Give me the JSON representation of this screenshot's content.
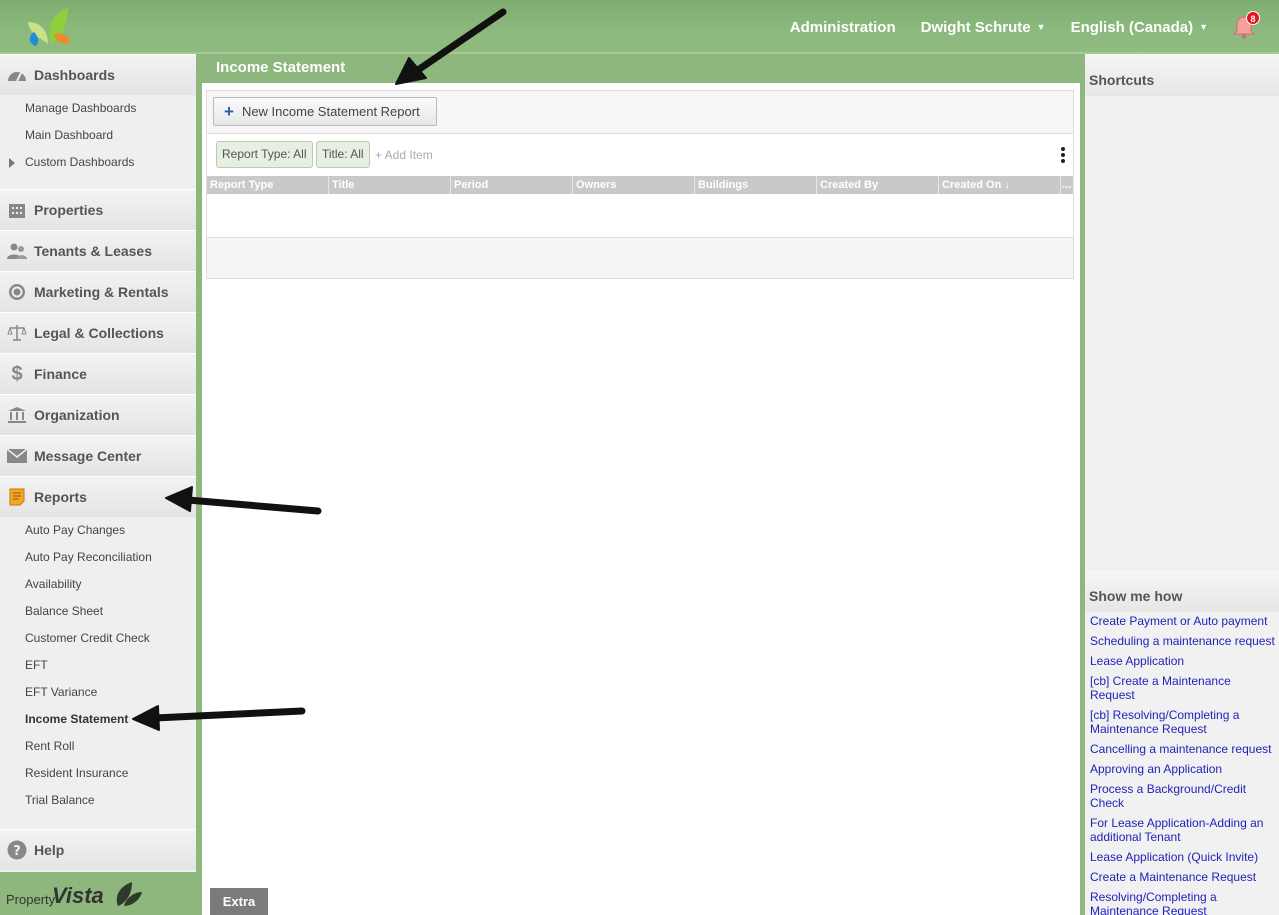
{
  "header": {
    "nav": [
      {
        "label": "Administration"
      },
      {
        "label": "Dwight Schrute"
      },
      {
        "label": "English (Canada)"
      }
    ],
    "notifications_count": "8"
  },
  "sidebar": {
    "sections": [
      {
        "label": "Dashboards",
        "icon": "gauge-icon",
        "children": [
          "Manage Dashboards",
          "Main Dashboard",
          "Custom Dashboards"
        ]
      },
      {
        "label": "Properties",
        "icon": "building-icon"
      },
      {
        "label": "Tenants & Leases",
        "icon": "people-icon"
      },
      {
        "label": "Marketing & Rentals",
        "icon": "target-icon"
      },
      {
        "label": "Legal & Collections",
        "icon": "scales-icon"
      },
      {
        "label": "Finance",
        "icon": "dollar-icon"
      },
      {
        "label": "Organization",
        "icon": "bank-icon"
      },
      {
        "label": "Message Center",
        "icon": "envelope-icon"
      },
      {
        "label": "Reports",
        "icon": "report-icon"
      },
      {
        "label": "Help",
        "icon": "help-icon"
      }
    ],
    "reports": [
      "Auto Pay Changes",
      "Auto Pay Reconciliation",
      "Availability",
      "Balance Sheet",
      "Customer Credit Check",
      "EFT",
      "EFT Variance",
      "Income Statement",
      "Rent Roll",
      "Resident Insurance",
      "Trial Balance"
    ],
    "active_report": "Income Statement",
    "brand_small": "Property",
    "brand_large": "Vista"
  },
  "main": {
    "title": "Income Statement",
    "new_button": "New Income Statement Report",
    "filters": [
      "Report Type: All",
      "Title: All"
    ],
    "add_item": "+ Add Item",
    "columns": [
      "Report Type",
      "Title",
      "Period",
      "Owners",
      "Buildings",
      "Created By",
      "Created On ↓",
      "..."
    ],
    "extra_button": "Extra"
  },
  "right": {
    "shortcuts_title": "Shortcuts",
    "howto_title": "Show me how",
    "links": [
      "Create Payment or Auto payment",
      "Scheduling a maintenance request",
      "Lease Application",
      "[cb] Create a Maintenance Request",
      "[cb] Resolving/Completing a Maintenance Request",
      "Cancelling a maintenance request",
      "Approving an Application",
      "Process a Background/Credit Check",
      "For Lease Application-Adding an additional Tenant",
      "Lease Application (Quick Invite)",
      "Create a Maintenance Request",
      "Resolving/Completing a Maintenance Request"
    ]
  },
  "colors": {
    "accent_green": "#8db77c",
    "link_blue": "#2222bb",
    "badge_red": "#e3161c"
  }
}
